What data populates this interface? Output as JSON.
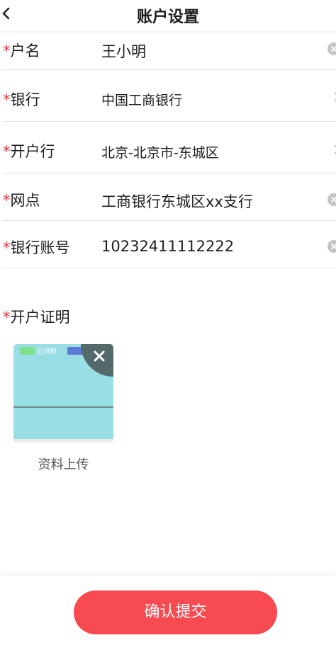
{
  "header": {
    "title": "账户设置",
    "back_icon": "chevron-left-icon"
  },
  "form": {
    "required_mark": "*",
    "fields": [
      {
        "label": "户名",
        "value": "王小明",
        "trailing": "clear-icon"
      },
      {
        "label": "银行",
        "value": "中国工商银行",
        "trailing": "chevron-right-icon"
      },
      {
        "label": "开户行",
        "value": "北京-北京市-东城区",
        "trailing": "chevron-right-icon"
      },
      {
        "label": "网点",
        "value": "工商银行东城区xx支行",
        "trailing": "clear-icon"
      },
      {
        "label": "银行账号",
        "value": "10232411112222",
        "trailing": "clear-icon"
      }
    ]
  },
  "proof": {
    "label": "开户证明",
    "thumbnail_badge": "已领取",
    "delete_icon": "close-icon",
    "caption": "资料上传"
  },
  "footer": {
    "submit_label": "确认提交",
    "accent": "#f84a51"
  }
}
